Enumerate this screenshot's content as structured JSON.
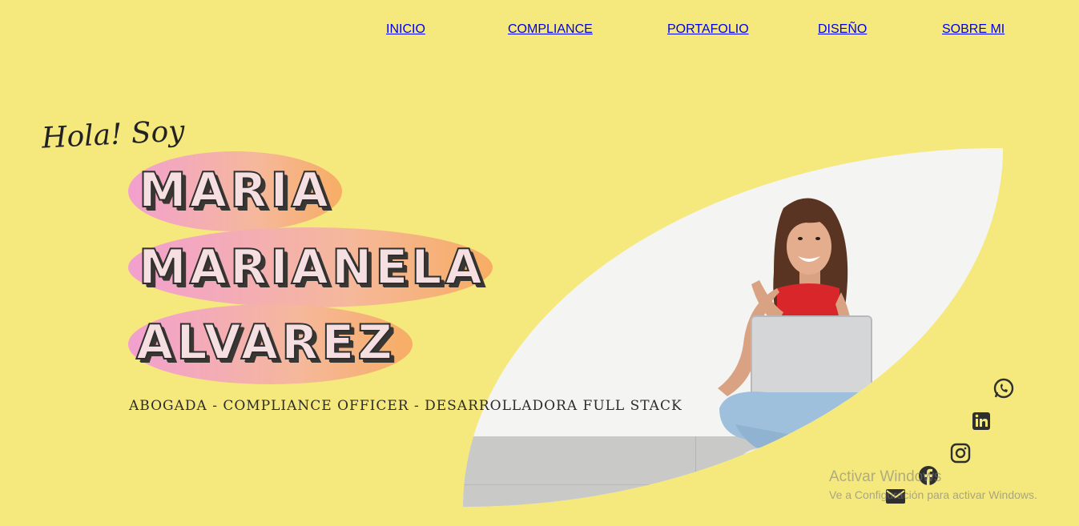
{
  "nav": {
    "items": [
      {
        "label": "INICIO"
      },
      {
        "label": "COMPLIANCE"
      },
      {
        "label": "PORTAFOLIO"
      },
      {
        "label": "DISEÑO"
      },
      {
        "label": "SOBRE MI"
      }
    ]
  },
  "hero": {
    "greeting": "Hola! Soy",
    "name_lines": [
      "MARIA",
      "MARIANELA",
      "ALVAREZ"
    ],
    "subtitle": "ABOGADA - COMPLIANCE OFFICER - DESARROLLADORA FULL STACK"
  },
  "social": {
    "icons": [
      "whatsapp-icon",
      "linkedin-icon",
      "instagram-icon",
      "facebook-icon",
      "email-icon"
    ]
  },
  "watermark": {
    "line1": "Activar Windows",
    "line2": "Ve a Configuración para activar Windows."
  },
  "colors": {
    "background": "#f5e97e",
    "blob_pink": "#f2a0cf",
    "blob_orange": "#f7ad64",
    "text_dark": "#2f2f2f"
  }
}
